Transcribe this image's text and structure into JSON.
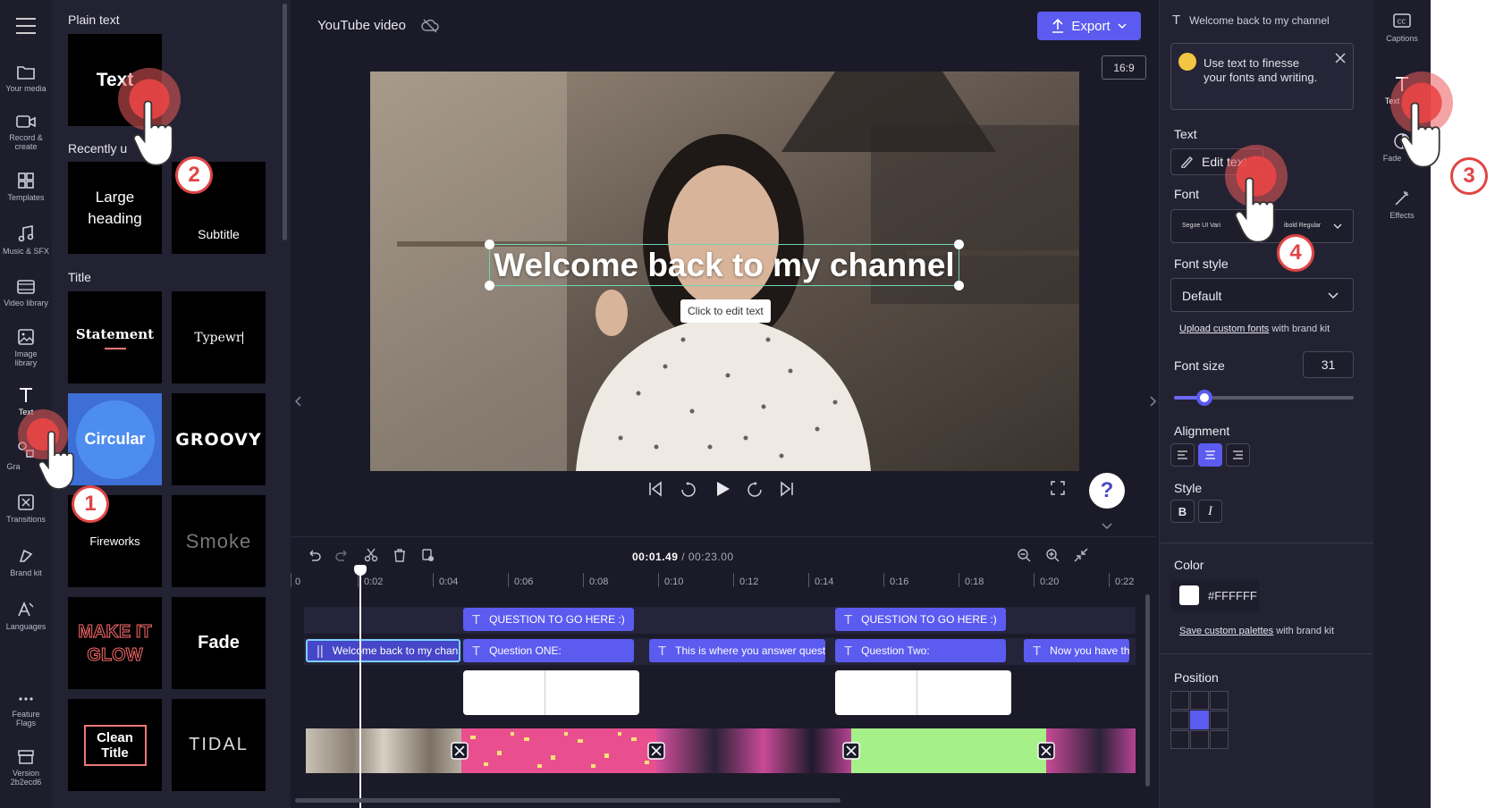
{
  "left_nav": {
    "items": [
      "Your media",
      "Record &\ncreate",
      "Templates",
      "Music & SFX",
      "Video library",
      "Image\nlibrary",
      "Text",
      "Gra",
      "Transitions",
      "Brand kit",
      "Languages",
      "Feature\nFlags",
      "Version\n2b2ecd6"
    ]
  },
  "text_panel": {
    "plain_text_heading": "Plain text",
    "recently_heading": "Recently u",
    "title_heading": "Title",
    "tiles": {
      "text": "Text",
      "large_heading": "Large heading",
      "subtitle": "Subtitle",
      "statement": "Statement",
      "typewriter": "Typewr",
      "circular": "Circular",
      "groovy": "GROOVY",
      "fireworks": "Fireworks",
      "smoke": "Smoke",
      "make_it_glow": "MAKE IT GLOW",
      "fade": "Fade",
      "clean_title": "Clean Title",
      "tidal": "TIDAL"
    }
  },
  "topbar": {
    "project_name": "YouTube video",
    "export_label": "Export"
  },
  "preview": {
    "aspect_ratio": "16:9",
    "overlay_text": "Welcome back to my channel",
    "tooltip": "Click to edit text"
  },
  "timeline": {
    "current_time": "00:01.49",
    "total_time": "/ 00:23.00",
    "ruler": [
      "0",
      "0:02",
      "0:04",
      "0:06",
      "0:08",
      "0:10",
      "0:12",
      "0:14",
      "0:16",
      "0:18",
      "0:20",
      "0:22"
    ],
    "clips": {
      "q1_top": "QUESTION TO GO HERE :)",
      "q2_top": "QUESTION TO GO HERE :)",
      "welcome": "Welcome back to my chann",
      "question_one": "Question ONE:",
      "answer": "This is where you answer questi",
      "question_two": "Question Two:",
      "now": "Now you have th"
    }
  },
  "right_panel": {
    "header": "Welcome back to my channel",
    "tip": "Use text to finesse your fonts and writing.",
    "text_label": "Text",
    "edit_text_label": "Edit text",
    "font_label": "Font",
    "font_value_left": "Segoe UI Vari",
    "font_value_right": "ibold Regular",
    "font_style_label": "Font style",
    "font_style_value": "Default",
    "upload_fonts_link": "Upload custom fonts",
    "upload_fonts_suffix": " with brand kit",
    "font_size_label": "Font size",
    "font_size_value": "31",
    "font_size_fraction": 0.17,
    "alignment_label": "Alignment",
    "style_label": "Style",
    "bold_label": "B",
    "italic_label": "I",
    "color_label": "Color",
    "color_value": "#FFFFFF",
    "save_palettes_link": "Save custom palettes",
    "save_palettes_suffix": " with brand kit",
    "position_label": "Position"
  },
  "right_tabs": {
    "captions": "Captions",
    "text": "Text",
    "fade": "Fade",
    "effects": "Effects"
  },
  "steps": [
    "1",
    "2",
    "3",
    "4"
  ],
  "colors": {
    "accent": "#5b5bf0",
    "tap": "#e04545"
  }
}
